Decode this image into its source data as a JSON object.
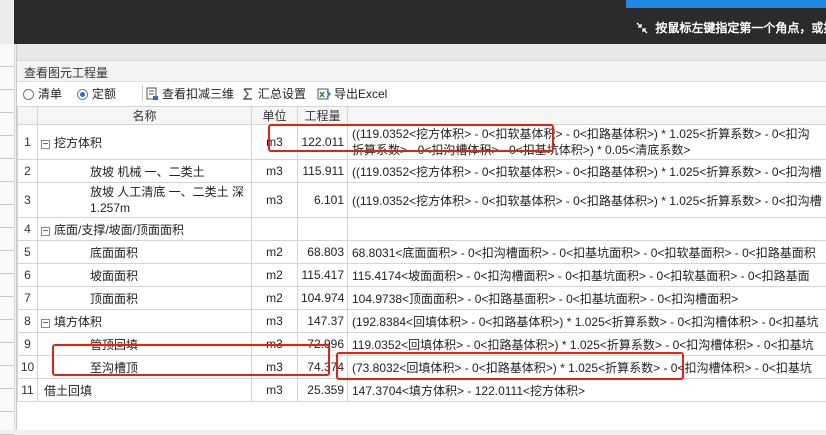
{
  "hint": {
    "text": "按鼠标左键指定第一个角点，或拾"
  },
  "panel": {
    "title": "查看图元工程量",
    "toolbar": {
      "list_label": "清单",
      "quota_label": "定额",
      "view_3d_label": "查看扣减三维",
      "summary_label": "汇总设置",
      "export_label": "导出Excel"
    },
    "columns": {
      "name": "名称",
      "unit": "单位",
      "qty": "工程量"
    }
  },
  "rows": [
    {
      "num": "1",
      "name": "挖方体积",
      "unit": "m3",
      "qty": "122.011",
      "expr": "((119.0352<挖方体积> - 0<扣软基体积> - 0<扣路基体积>) * 1.025<折算系数> - 0<扣沟",
      "expr2": "折算系数> - 0<扣沟槽体积> - 0<扣基坑体积>) * 0.05<清底系数>"
    },
    {
      "num": "2",
      "name": "放坡 机械 一、二类土",
      "unit": "m3",
      "qty": "115.911",
      "expr": "((119.0352<挖方体积> - 0<扣软基体积> - 0<扣路基体积>) * 1.025<折算系数> - 0<扣沟槽"
    },
    {
      "num": "3",
      "name": "放坡 人工清底 一、二类土 深",
      "name2": "1.257m",
      "unit": "m3",
      "qty": "6.101",
      "expr": "((119.0352<挖方体积> - 0<扣软基体积> - 0<扣路基体积>) * 1.025<折算系数> - 0<扣沟槽"
    },
    {
      "num": "4",
      "name": "底面/支撑/坡面/顶面面积",
      "unit": "",
      "qty": "",
      "expr": ""
    },
    {
      "num": "5",
      "name": "底面面积",
      "unit": "m2",
      "qty": "68.803",
      "expr": "68.8031<底面面积> - 0<扣沟槽面积> - 0<扣基坑面积> - 0<扣软基面积> - 0<扣路基面积"
    },
    {
      "num": "6",
      "name": "坡面面积",
      "unit": "m2",
      "qty": "115.417",
      "expr": "115.4174<坡面面积> - 0<扣沟槽面积> - 0<扣基坑面积> - 0<扣软基面积> - 0<扣路基面"
    },
    {
      "num": "7",
      "name": "顶面面积",
      "unit": "m2",
      "qty": "104.974",
      "expr": "104.9738<顶面面积> - 0<扣路基面积> - 0<扣基坑面积> - 0<扣沟槽面积>"
    },
    {
      "num": "8",
      "name": "填方体积",
      "unit": "m3",
      "qty": "147.37",
      "expr": "(192.8384<回填体积> - 0<扣路基体积>) * 1.025<折算系数> - 0<扣沟槽体积> - 0<扣基坑"
    },
    {
      "num": "9",
      "name": "管顶回填",
      "unit": "m3",
      "qty": "72.996",
      "expr": "119.0352<回填体积> - 0<扣路基体积>) * 1.025<折算系数> - 0<扣沟槽体积> - 0<扣基坑"
    },
    {
      "num": "10",
      "name": "至沟槽顶",
      "unit": "m3",
      "qty": "74.374",
      "expr": "(73.8032<回填体积> - 0<扣路基体积>) * 1.025<折算系数> - 0<扣沟槽体积> - 0<扣基坑"
    },
    {
      "num": "11",
      "name": "借土回填",
      "unit": "m3",
      "qty": "25.359",
      "expr": "147.3704<填方体积> - 122.0111<挖方体积>"
    }
  ],
  "colors": {
    "highlight": "#e8200e",
    "accent": "#1a73d9",
    "topbar": "#2b2b2b"
  }
}
